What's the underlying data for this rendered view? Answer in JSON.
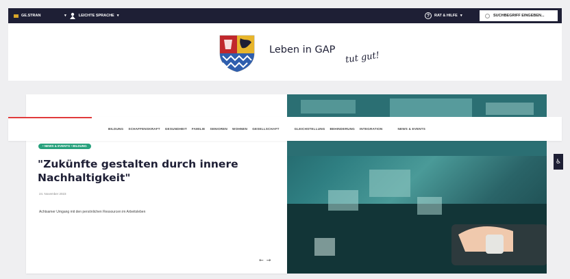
{
  "topbar": {
    "region_label": "GE.STRAN",
    "language_label": "LEICHTE SPRACHE",
    "help_label": "RAT & HILFE",
    "search_placeholder": "SUCHBEGRIFF EINGEBEN..."
  },
  "header": {
    "brand": "Leben in GAP",
    "tagline": "tut gut!"
  },
  "nav": {
    "items": [
      "BILDUNG",
      "SCHAFFENSKRAFT",
      "GESUNDHEIT",
      "FAMILIE",
      "SENIOREN",
      "WOHNEN",
      "GESELLSCHAFT",
      "GLEICHSTELLUNG",
      "BEHINDERUNG",
      "INTEGRATION",
      "NEWS & EVENTS"
    ]
  },
  "article": {
    "badge": "• NEWS & EVENTS • BILDUNG",
    "title": "\"Zukünfte gestalten durch innere Nachhaltigkeit\"",
    "date": "24. November 2023",
    "teaser": "Achtsamer Umgang mit den persönlichen Ressourcen im Arbeitsleben",
    "prev_arrow": "←",
    "next_arrow": "→"
  },
  "colors": {
    "topbar": "#1e1f35",
    "accent_red": "#e0393a",
    "badge_green": "#27a17c",
    "crest_blue": "#2f5fae",
    "crest_red": "#c0282d",
    "crest_gold": "#e7b52c"
  },
  "icons": {
    "flag": "flag-icon",
    "language": "language-icon",
    "help": "help-icon",
    "search": "search-icon",
    "accessibility": "accessibility-icon"
  }
}
